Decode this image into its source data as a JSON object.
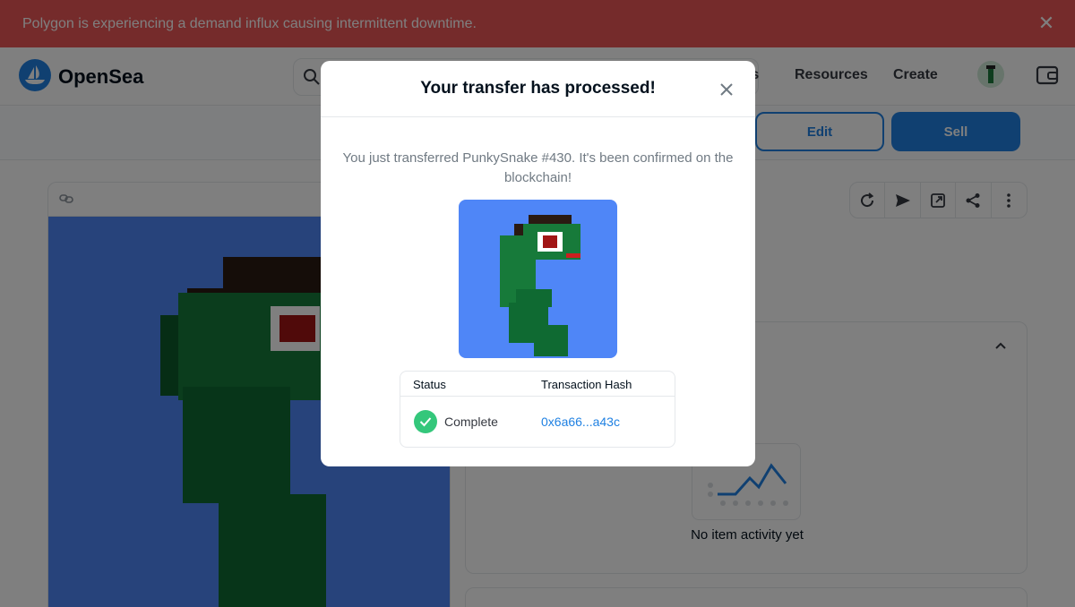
{
  "banner": {
    "text": "Polygon is experiencing a demand influx causing intermittent downtime."
  },
  "nav": {
    "brand": "OpenSea",
    "links": [
      "ts",
      "Resources",
      "Create"
    ]
  },
  "actions": {
    "edit_label": "Edit",
    "sell_label": "Sell"
  },
  "activity": {
    "empty_text": "No item activity yet"
  },
  "modal": {
    "title": "Your transfer has processed!",
    "message": "You just transferred PunkySnake #430. It's been confirmed on the blockchain!",
    "table": {
      "col_status": "Status",
      "col_hash": "Transaction Hash",
      "status_value": "Complete",
      "hash_value": "0x6a66...a43c"
    }
  },
  "colors": {
    "accent": "#2081e2",
    "success": "#34c77b",
    "banner": "#eb5757",
    "nft_bg": "#4f86f7"
  }
}
